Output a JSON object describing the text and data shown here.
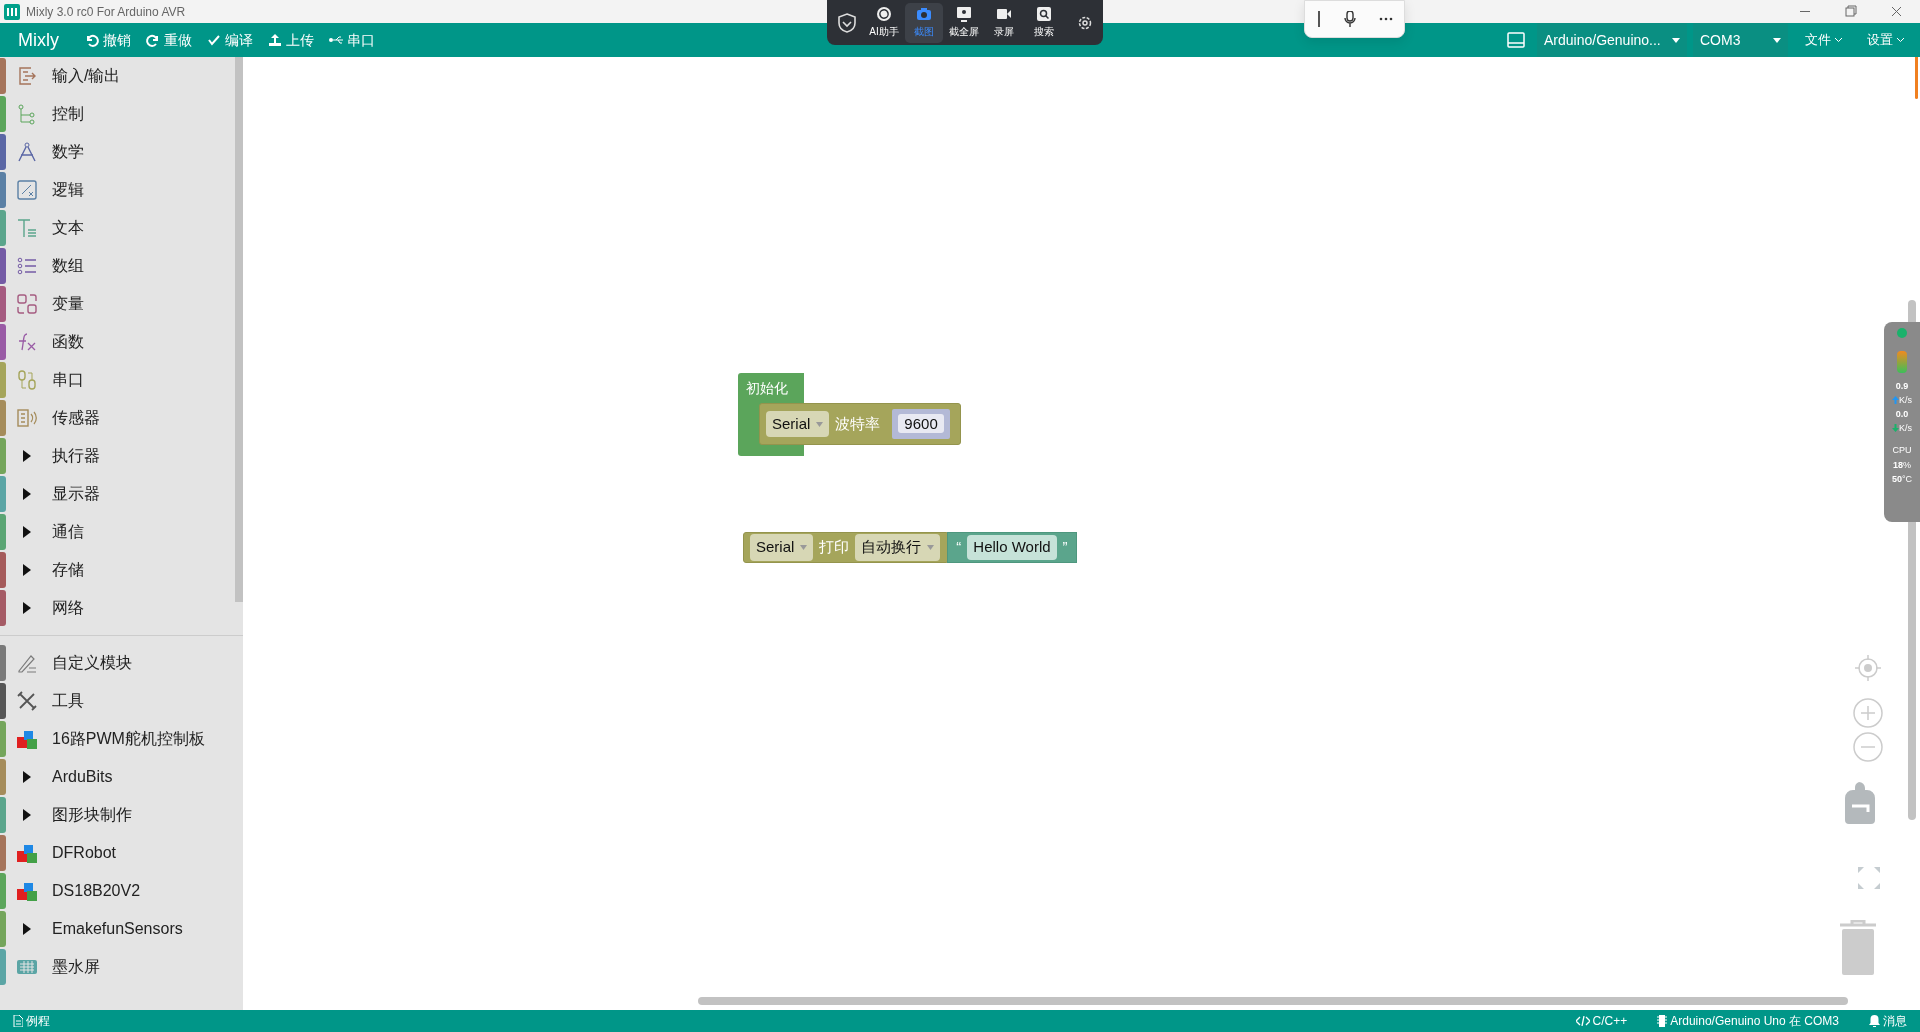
{
  "window": {
    "title": "Mixly 3.0 rc0 For Arduino AVR"
  },
  "menubar": {
    "brand": "Mixly",
    "actions": [
      {
        "kind": "undo",
        "label": "撤销"
      },
      {
        "kind": "redo",
        "label": "重做"
      },
      {
        "kind": "compile",
        "label": "编译"
      },
      {
        "kind": "upload",
        "label": "上传"
      },
      {
        "kind": "serial",
        "label": "串口"
      }
    ],
    "board": "Arduino/Genuino...",
    "port": "COM3",
    "menus": [
      "文件",
      "设置"
    ]
  },
  "capture_toolbar": {
    "tools": [
      {
        "label": "AI助手",
        "selected": false
      },
      {
        "label": "截图",
        "selected": true
      },
      {
        "label": "截全屏",
        "selected": false
      },
      {
        "label": "录屏",
        "selected": false
      },
      {
        "label": "搜索",
        "selected": false
      }
    ]
  },
  "sidebar": {
    "items": [
      {
        "kind": "category",
        "label": "输入/输出",
        "color": "#a5745b"
      },
      {
        "kind": "category",
        "label": "控制",
        "color": "#5ba55b"
      },
      {
        "kind": "category",
        "label": "数学",
        "color": "#5b67a5"
      },
      {
        "kind": "category",
        "label": "逻辑",
        "color": "#5b80a5"
      },
      {
        "kind": "category",
        "label": "文本",
        "color": "#5ba58c"
      },
      {
        "kind": "category",
        "label": "数组",
        "color": "#745ba5"
      },
      {
        "kind": "category",
        "label": "变量",
        "color": "#a55b80"
      },
      {
        "kind": "category",
        "label": "函数",
        "color": "#995ba5"
      },
      {
        "kind": "category",
        "label": "串口",
        "color": "#a5a55b"
      },
      {
        "kind": "category",
        "label": "传感器",
        "color": "#a58c5b"
      },
      {
        "kind": "folder",
        "label": "执行器",
        "color": "#74a55b",
        "expanded": false
      },
      {
        "kind": "folder",
        "label": "显示器",
        "color": "#5ba5a5",
        "expanded": false
      },
      {
        "kind": "folder",
        "label": "通信",
        "color": "#5ba574",
        "expanded": false
      },
      {
        "kind": "folder",
        "label": "存储",
        "color": "#a55b5b",
        "expanded": false
      },
      {
        "kind": "folder",
        "label": "网络",
        "color": "#a55b65",
        "expanded": false
      },
      {
        "kind": "separator"
      },
      {
        "kind": "category",
        "label": "自定义模块",
        "color": "#7a7a7a"
      },
      {
        "kind": "category",
        "label": "工具",
        "color": "#555555"
      },
      {
        "kind": "library",
        "label": "16路PWM舵机控制板",
        "color": "#74a55b"
      },
      {
        "kind": "folder",
        "label": "ArduBits",
        "color": "#a58c5b",
        "expanded": false
      },
      {
        "kind": "folder",
        "label": "图形块制作",
        "color": "#5ba58c",
        "expanded": false
      },
      {
        "kind": "library",
        "label": "DFRobot",
        "color": "#a5745b"
      },
      {
        "kind": "library",
        "label": "DS18B20V2",
        "color": "#5ba55b"
      },
      {
        "kind": "folder",
        "label": "EmakefunSensors",
        "color": "#74a55b",
        "expanded": false
      },
      {
        "kind": "category",
        "label": "墨水屏",
        "color": "#5ba5a5"
      }
    ]
  },
  "canvas": {
    "blocks": [
      {
        "kind": "setup",
        "title": "初始化",
        "port": "Serial",
        "label": "波特率",
        "value": "9600"
      },
      {
        "kind": "print",
        "port": "Serial",
        "label": "打印",
        "mode": "自动换行",
        "open_quote": "“",
        "text": "Hello World",
        "close_quote": "”"
      }
    ]
  },
  "monitor_widget": {
    "up": "0.9",
    "up_unit": "K/s",
    "down": "0.0",
    "down_unit": "K/s",
    "cpu_label": "CPU",
    "cpu": "18",
    "cpu_unit": "%",
    "temp": "50",
    "temp_unit": "°C"
  },
  "status_bar": {
    "examples": "例程",
    "language": "C/C++",
    "board": "Arduino/Genuino Uno 在 COM3",
    "messages": "消息"
  }
}
